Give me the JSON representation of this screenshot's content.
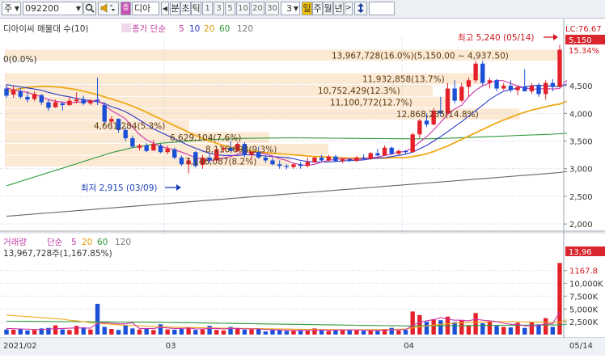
{
  "toolbar": {
    "market": "주",
    "code": "092200",
    "name": "디아",
    "periods": [
      "분",
      "초",
      "틱",
      "1",
      "3",
      "5",
      "10",
      "20",
      "30"
    ],
    "interval": "3",
    "views": [
      "일",
      "주",
      "월",
      "년"
    ]
  },
  "price_panel": {
    "legend_title": "디아이씨 매물대 수(10)",
    "ma_label": "종가 단순",
    "ma_periods": [
      "5",
      "10",
      "20",
      "60",
      "120"
    ],
    "lc_label": "LC:76.67",
    "current_price": "5,150",
    "current_pct": "15.34%",
    "y_ticks": [
      "4,500",
      "4,000",
      "3,500",
      "3,000",
      "2,500",
      "2,000"
    ],
    "high_label": "최고 5,240 (05/14)",
    "low_label": "최저 2,915 (03/09)",
    "top_row_text": "0(0.0%)",
    "volume_profile": [
      "13,967,728(16.0%)(5,150.00 ~ 4,937.50)",
      "11,932,858(13.7%)",
      "10,752,429(12.3%)",
      "11,100,772(12.7%)",
      "12,868,235(14.8%)",
      "4,661,284(5.3%)",
      "6,629,104(7.6%)",
      "8,116,693(9.3%)",
      "7,146,087(8.2%)"
    ]
  },
  "volume_panel": {
    "legend_title": "거래량",
    "ma_label": "단순",
    "ma_periods": [
      "5",
      "20",
      "60",
      "120"
    ],
    "last_volume_text": "13,967,728주(1,167.85%)",
    "current_volume": "13,96",
    "y_ticks": [
      "1167.8",
      "10,000K",
      "7,500K",
      "5,000K",
      "2,500K"
    ]
  },
  "x_axis": [
    "2021/02",
    "03",
    "04",
    "05",
    "05/14"
  ],
  "colors": {
    "up": "#e4202a",
    "down": "#1c4fd8",
    "ma5": "#cc33aa",
    "ma10": "#2a39c8",
    "ma20": "#f0a818",
    "ma60": "#2f9a3c",
    "ma120": "#666666",
    "profile": "#fbe9d4"
  },
  "chart_data": {
    "type": "candlestick",
    "ylim": [
      1900,
      5700
    ],
    "volume_ylim": [
      0,
      14500000
    ],
    "candles": [
      {
        "o": 4450,
        "h": 4520,
        "l": 4280,
        "c": 4320
      },
      {
        "o": 4340,
        "h": 4500,
        "l": 4280,
        "c": 4420
      },
      {
        "o": 4400,
        "h": 4460,
        "l": 4260,
        "c": 4300
      },
      {
        "o": 4300,
        "h": 4400,
        "l": 4200,
        "c": 4250
      },
      {
        "o": 4260,
        "h": 4400,
        "l": 4220,
        "c": 4350
      },
      {
        "o": 4330,
        "h": 4350,
        "l": 4150,
        "c": 4200
      },
      {
        "o": 4200,
        "h": 4250,
        "l": 4050,
        "c": 4100
      },
      {
        "o": 4110,
        "h": 4250,
        "l": 4100,
        "c": 4200
      },
      {
        "o": 4180,
        "h": 4220,
        "l": 4050,
        "c": 4150
      },
      {
        "o": 4150,
        "h": 4300,
        "l": 4140,
        "c": 4230
      },
      {
        "o": 4220,
        "h": 4380,
        "l": 4180,
        "c": 4250
      },
      {
        "o": 4250,
        "h": 4320,
        "l": 4150,
        "c": 4180
      },
      {
        "o": 4180,
        "h": 4260,
        "l": 4150,
        "c": 4230
      },
      {
        "o": 4250,
        "h": 4650,
        "l": 4150,
        "c": 4230
      },
      {
        "o": 4150,
        "h": 4200,
        "l": 3800,
        "c": 3850
      },
      {
        "o": 3850,
        "h": 3950,
        "l": 3720,
        "c": 3900
      },
      {
        "o": 3900,
        "h": 3910,
        "l": 3650,
        "c": 3700
      },
      {
        "o": 3700,
        "h": 3750,
        "l": 3500,
        "c": 3550
      },
      {
        "o": 3550,
        "h": 3600,
        "l": 3380,
        "c": 3400
      },
      {
        "o": 3380,
        "h": 3450,
        "l": 3330,
        "c": 3420
      },
      {
        "o": 3420,
        "h": 3460,
        "l": 3300,
        "c": 3320
      },
      {
        "o": 3330,
        "h": 3520,
        "l": 3320,
        "c": 3450
      },
      {
        "o": 3420,
        "h": 3450,
        "l": 3280,
        "c": 3300
      },
      {
        "o": 3300,
        "h": 3420,
        "l": 3260,
        "c": 3360
      },
      {
        "o": 3350,
        "h": 3380,
        "l": 3170,
        "c": 3200
      },
      {
        "o": 3200,
        "h": 3240,
        "l": 3050,
        "c": 3080
      },
      {
        "o": 3080,
        "h": 3200,
        "l": 2915,
        "c": 3150
      },
      {
        "o": 3300,
        "h": 3320,
        "l": 3020,
        "c": 3050
      },
      {
        "o": 3070,
        "h": 3250,
        "l": 3000,
        "c": 3200
      },
      {
        "o": 3200,
        "h": 3280,
        "l": 3100,
        "c": 3150
      },
      {
        "o": 3150,
        "h": 3380,
        "l": 3120,
        "c": 3350
      },
      {
        "o": 3350,
        "h": 3400,
        "l": 3300,
        "c": 3380
      },
      {
        "o": 3380,
        "h": 3500,
        "l": 3320,
        "c": 3320
      },
      {
        "o": 3320,
        "h": 3480,
        "l": 3300,
        "c": 3450
      },
      {
        "o": 3450,
        "h": 3480,
        "l": 3200,
        "c": 3250
      },
      {
        "o": 3250,
        "h": 3320,
        "l": 3150,
        "c": 3300
      },
      {
        "o": 3300,
        "h": 3400,
        "l": 3180,
        "c": 3200
      },
      {
        "o": 3200,
        "h": 3250,
        "l": 3100,
        "c": 3150
      },
      {
        "o": 3150,
        "h": 3200,
        "l": 3060,
        "c": 3080
      },
      {
        "o": 3080,
        "h": 3150,
        "l": 3000,
        "c": 3050
      },
      {
        "o": 3050,
        "h": 3080,
        "l": 2990,
        "c": 3030
      },
      {
        "o": 3030,
        "h": 3100,
        "l": 3000,
        "c": 3080
      },
      {
        "o": 3080,
        "h": 3120,
        "l": 3000,
        "c": 3050
      },
      {
        "o": 3050,
        "h": 3200,
        "l": 3020,
        "c": 3120
      },
      {
        "o": 3120,
        "h": 3220,
        "l": 3100,
        "c": 3200
      },
      {
        "o": 3200,
        "h": 3250,
        "l": 3120,
        "c": 3150
      },
      {
        "o": 3150,
        "h": 3250,
        "l": 3130,
        "c": 3220
      },
      {
        "o": 3220,
        "h": 3250,
        "l": 3120,
        "c": 3140
      },
      {
        "o": 3140,
        "h": 3190,
        "l": 3100,
        "c": 3170
      },
      {
        "o": 3170,
        "h": 3200,
        "l": 3120,
        "c": 3140
      },
      {
        "o": 3140,
        "h": 3230,
        "l": 3120,
        "c": 3200
      },
      {
        "o": 3200,
        "h": 3260,
        "l": 3150,
        "c": 3180
      },
      {
        "o": 3180,
        "h": 3300,
        "l": 3160,
        "c": 3280
      },
      {
        "o": 3280,
        "h": 3360,
        "l": 3220,
        "c": 3240
      },
      {
        "o": 3240,
        "h": 3420,
        "l": 3230,
        "c": 3380
      },
      {
        "o": 3380,
        "h": 3400,
        "l": 3250,
        "c": 3270
      },
      {
        "o": 3270,
        "h": 3350,
        "l": 3250,
        "c": 3320
      },
      {
        "o": 3320,
        "h": 3340,
        "l": 3260,
        "c": 3300
      },
      {
        "o": 3300,
        "h": 3650,
        "l": 3290,
        "c": 3620
      },
      {
        "o": 3620,
        "h": 3900,
        "l": 3550,
        "c": 3870
      },
      {
        "o": 3870,
        "h": 4000,
        "l": 3750,
        "c": 3800
      },
      {
        "o": 3800,
        "h": 4100,
        "l": 3780,
        "c": 4050
      },
      {
        "o": 4050,
        "h": 4300,
        "l": 3950,
        "c": 4000
      },
      {
        "o": 4000,
        "h": 4550,
        "l": 3980,
        "c": 4450
      },
      {
        "o": 4450,
        "h": 4600,
        "l": 4180,
        "c": 4230
      },
      {
        "o": 4230,
        "h": 4550,
        "l": 4200,
        "c": 4480
      },
      {
        "o": 4480,
        "h": 4650,
        "l": 4300,
        "c": 4600
      },
      {
        "o": 4600,
        "h": 4950,
        "l": 4550,
        "c": 4900
      },
      {
        "o": 4900,
        "h": 4950,
        "l": 4500,
        "c": 4550
      },
      {
        "o": 4550,
        "h": 4650,
        "l": 4450,
        "c": 4600
      },
      {
        "o": 4600,
        "h": 4620,
        "l": 4400,
        "c": 4450
      },
      {
        "o": 4450,
        "h": 4550,
        "l": 4420,
        "c": 4500
      },
      {
        "o": 4500,
        "h": 4600,
        "l": 4380,
        "c": 4420
      },
      {
        "o": 4420,
        "h": 4500,
        "l": 4330,
        "c": 4480
      },
      {
        "o": 4480,
        "h": 4800,
        "l": 4400,
        "c": 4400
      },
      {
        "o": 4400,
        "h": 4550,
        "l": 4350,
        "c": 4500
      },
      {
        "o": 4500,
        "h": 4550,
        "l": 4300,
        "c": 4350
      },
      {
        "o": 4350,
        "h": 4600,
        "l": 4250,
        "c": 4550
      },
      {
        "o": 4550,
        "h": 4620,
        "l": 4400,
        "c": 4480
      },
      {
        "o": 4480,
        "h": 5240,
        "l": 4470,
        "c": 5150
      }
    ],
    "volume": [
      1000000,
      950000,
      1100000,
      800000,
      900000,
      1200000,
      1300000,
      1800000,
      1000000,
      900000,
      1700000,
      1400000,
      1000000,
      6000000,
      1500000,
      1100000,
      900000,
      1900000,
      1200000,
      1000000,
      1100000,
      900000,
      2000000,
      1000000,
      950000,
      1100000,
      1300000,
      900000,
      1000000,
      1700000,
      900000,
      800000,
      1500000,
      1200000,
      950000,
      1000000,
      1100000,
      600000,
      900000,
      850000,
      700000,
      800000,
      900000,
      750000,
      1200000,
      800000,
      700000,
      900000,
      1000000,
      850000,
      800000,
      750000,
      900000,
      700000,
      1100000,
      1300000,
      800000,
      900000,
      4500000,
      3800000,
      2500000,
      3000000,
      2800000,
      3500000,
      2400000,
      2800000,
      1800000,
      4200000,
      2200000,
      2600000,
      1700000,
      1500000,
      1400000,
      2300000,
      1300000,
      2500000,
      2000000,
      3200000,
      1500000,
      13967728
    ],
    "ma5": [
      4460,
      4430,
      4400,
      4380,
      4340,
      4300,
      4250,
      4220,
      4200,
      4190,
      4200,
      4210,
      4220,
      4240,
      4150,
      4050,
      3980,
      3900,
      3750,
      3620,
      3520,
      3460,
      3400,
      3370,
      3340,
      3300,
      3250,
      3200,
      3170,
      3150,
      3160,
      3190,
      3220,
      3260,
      3300,
      3300,
      3290,
      3270,
      3230,
      3180,
      3150,
      3100,
      3070,
      3060,
      3080,
      3120,
      3150,
      3170,
      3180,
      3170,
      3170,
      3180,
      3200,
      3210,
      3240,
      3260,
      3300,
      3310,
      3380,
      3480,
      3580,
      3700,
      3840,
      3980,
      4080,
      4150,
      4300,
      4420,
      4500,
      4550,
      4600,
      4590,
      4540,
      4500,
      4460,
      4440,
      4440,
      4450,
      4440,
      4450,
      4600
    ],
    "ma10": [
      4520,
      4500,
      4480,
      4460,
      4440,
      4420,
      4380,
      4350,
      4320,
      4300,
      4270,
      4250,
      4230,
      4210,
      4180,
      4120,
      4080,
      4030,
      3960,
      3880,
      3800,
      3720,
      3660,
      3600,
      3540,
      3480,
      3420,
      3370,
      3320,
      3280,
      3250,
      3240,
      3240,
      3240,
      3250,
      3250,
      3240,
      3230,
      3220,
      3210,
      3200,
      3180,
      3150,
      3130,
      3120,
      3120,
      3120,
      3130,
      3140,
      3150,
      3150,
      3160,
      3180,
      3190,
      3200,
      3220,
      3240,
      3260,
      3300,
      3360,
      3420,
      3500,
      3580,
      3670,
      3760,
      3850,
      3950,
      4050,
      4150,
      4250,
      4330,
      4400,
      4430,
      4460,
      4480,
      4500,
      4510,
      4500,
      4490,
      4480,
      4530
    ],
    "ma20": [
      4400,
      4420,
      4450,
      4470,
      4480,
      4490,
      4490,
      4480,
      4470,
      4450,
      4430,
      4400,
      4370,
      4340,
      4300,
      4260,
      4220,
      4180,
      4130,
      4080,
      4020,
      3960,
      3900,
      3840,
      3780,
      3720,
      3660,
      3600,
      3550,
      3500,
      3460,
      3420,
      3390,
      3360,
      3340,
      3320,
      3300,
      3290,
      3280,
      3270,
      3260,
      3250,
      3240,
      3230,
      3220,
      3220,
      3210,
      3200,
      3200,
      3190,
      3190,
      3190,
      3190,
      3190,
      3190,
      3200,
      3200,
      3200,
      3220,
      3240,
      3270,
      3310,
      3360,
      3410,
      3470,
      3530,
      3590,
      3650,
      3710,
      3770,
      3830,
      3880,
      3930,
      3980,
      4020,
      4060,
      4090,
      4120,
      4150,
      4170,
      4220
    ],
    "ma60": [
      2690,
      2730,
      2770,
      2810,
      2850,
      2890,
      2930,
      2970,
      3010,
      3050,
      3090,
      3130,
      3170,
      3210,
      3250,
      3290,
      3320,
      3350,
      3380,
      3400,
      3420,
      3440,
      3460,
      3470,
      3480,
      3490,
      3500,
      3510,
      3520,
      3525,
      3530,
      3535,
      3540,
      3545,
      3548,
      3550,
      3552,
      3554,
      3555,
      3556,
      3557,
      3557,
      3557,
      3556,
      3555,
      3554,
      3553,
      3552,
      3550,
      3549,
      3548,
      3547,
      3546,
      3545,
      3544,
      3543,
      3542,
      3541,
      3540,
      3540,
      3541,
      3543,
      3546,
      3550,
      3555,
      3560,
      3565,
      3570,
      3575,
      3580,
      3585,
      3590,
      3595,
      3600,
      3605,
      3610,
      3615,
      3620,
      3625,
      3630,
      3640
    ],
    "ma120": [
      2140,
      2150,
      2160,
      2170,
      2180,
      2190,
      2200,
      2210,
      2220,
      2230,
      2240,
      2250,
      2260,
      2270,
      2280,
      2290,
      2300,
      2310,
      2320,
      2330,
      2340,
      2350,
      2360,
      2370,
      2380,
      2390,
      2400,
      2410,
      2420,
      2430,
      2440,
      2450,
      2460,
      2470,
      2480,
      2490,
      2500,
      2510,
      2520,
      2530,
      2540,
      2550,
      2560,
      2570,
      2580,
      2590,
      2600,
      2610,
      2620,
      2630,
      2640,
      2650,
      2660,
      2670,
      2680,
      2690,
      2700,
      2710,
      2720,
      2730,
      2740,
      2750,
      2760,
      2770,
      2780,
      2790,
      2800,
      2810,
      2820,
      2830,
      2840,
      2850,
      2860,
      2870,
      2880,
      2890,
      2900,
      2910,
      2920,
      2930,
      2950
    ],
    "volume_ma5": [
      1200000,
      1150000,
      1100000,
      1050000,
      1000000,
      1000000,
      1050000,
      1150000,
      1200000,
      1250000,
      1300000,
      1300000,
      1250000,
      2200000,
      2300000,
      2200000,
      2100000,
      2100000,
      2300000,
      1200000,
      1200000,
      1200000,
      1400000,
      1300000,
      1200000,
      1200000,
      1300000,
      1100000,
      1100000,
      1200000,
      1200000,
      1100000,
      1200000,
      1200000,
      1100000,
      1100000,
      1100000,
      1000000,
      950000,
      900000,
      850000,
      800000,
      800000,
      800000,
      850000,
      900000,
      850000,
      850000,
      900000,
      900000,
      900000,
      850000,
      800000,
      800000,
      850000,
      950000,
      950000,
      950000,
      1800000,
      2400000,
      2700000,
      2900000,
      3300000,
      3000000,
      2800000,
      2800000,
      2700000,
      3000000,
      2800000,
      2700000,
      2500000,
      2200000,
      2000000,
      2000000,
      1700000,
      1700000,
      1800000,
      2100000,
      2100000,
      4400000
    ],
    "volume_ma20": [
      3800000,
      3700000,
      3600000,
      3500000,
      3400000,
      3300000,
      3200000,
      3100000,
      3000000,
      2800000,
      2700000,
      2500000,
      2300000,
      2200000,
      2100000,
      2000000,
      1900000,
      1800000,
      1750000,
      1700000,
      1650000,
      1600000,
      1550000,
      1500000,
      1450000,
      1400000,
      1380000,
      1350000,
      1330000,
      1300000,
      1280000,
      1260000,
      1240000,
      1220000,
      1200000,
      1180000,
      1160000,
      1140000,
      1120000,
      1100000,
      1080000,
      1060000,
      1040000,
      1020000,
      1000000,
      990000,
      980000,
      970000,
      960000,
      950000,
      950000,
      950000,
      960000,
      970000,
      980000,
      1000000,
      1050000,
      1100000,
      1300000,
      1500000,
      1700000,
      1850000,
      2000000,
      2100000,
      2200000,
      2300000,
      2350000,
      2400000,
      2450000,
      2480000,
      2500000,
      2500000,
      2500000,
      2480000,
      2450000,
      2430000,
      2420000,
      2410000,
      2400000,
      2400000,
      2900000
    ],
    "volume_ma60": [
      2600000,
      2600000,
      2590000,
      2580000,
      2570000,
      2560000,
      2550000,
      2540000,
      2530000,
      2520000,
      2510000,
      2500000,
      2490000,
      2480000,
      2470000,
      2460000,
      2450000,
      2440000,
      2430000,
      2420000,
      2410000,
      2400000,
      2380000,
      2360000,
      2340000,
      2320000,
      2300000,
      2280000,
      2260000,
      2240000,
      2220000,
      2200000,
      2180000,
      2160000,
      2140000,
      2120000,
      2100000,
      2080000,
      2060000,
      2040000,
      2020000,
      2000000,
      1980000,
      1960000,
      1940000,
      1920000,
      1900000,
      1880000,
      1860000,
      1840000,
      1820000,
      1800000,
      1780000,
      1760000,
      1740000,
      1720000,
      1700000,
      1680000,
      1680000,
      1690000,
      1700000,
      1710000,
      1720000,
      1730000,
      1740000,
      1750000,
      1760000,
      1770000,
      1780000,
      1790000,
      1800000,
      1810000,
      1820000,
      1830000,
      1840000,
      1850000,
      1860000,
      1870000,
      1880000,
      1890000,
      2000000
    ]
  }
}
